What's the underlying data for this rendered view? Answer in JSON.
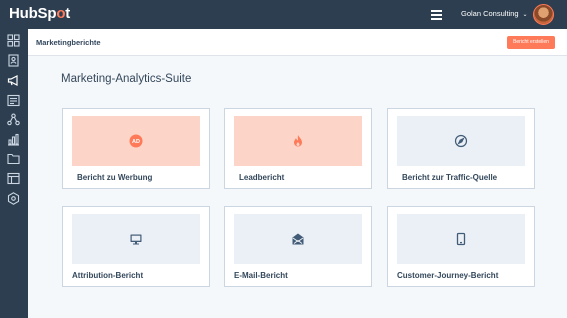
{
  "app": {
    "logo_pre": "HubSp",
    "logo_dot": "o",
    "logo_post": "t"
  },
  "topbar": {
    "account_name": "Golan Consulting"
  },
  "header": {
    "title": "Marketingberichte",
    "create_button": "Bericht erstellen"
  },
  "main": {
    "title": "Marketing-Analytics-Suite",
    "cards": [
      {
        "label": "Bericht zu Werbung",
        "icon": "ad-badge-icon",
        "ad_text": "AD",
        "tone": "orange"
      },
      {
        "label": "Leadbericht",
        "icon": "flame-icon",
        "tone": "orange"
      },
      {
        "label": "Bericht zur Traffic-Quelle",
        "icon": "compass-icon",
        "tone": "grey"
      },
      {
        "label": "Attribution-Bericht",
        "icon": "monitor-icon",
        "tone": "grey"
      },
      {
        "label": "E-Mail-Bericht",
        "icon": "open-envelope-icon",
        "tone": "grey"
      },
      {
        "label": "Customer-Journey-Bericht",
        "icon": "tablet-icon",
        "tone": "grey"
      }
    ]
  },
  "sidebar": {
    "items": [
      {
        "icon": "dashboard-grid-icon"
      },
      {
        "icon": "contacts-icon"
      },
      {
        "icon": "marketing-megaphone-icon"
      },
      {
        "icon": "content-icon"
      },
      {
        "icon": "automation-icon"
      },
      {
        "icon": "reports-bar-chart-icon"
      },
      {
        "icon": "folder-icon"
      },
      {
        "icon": "library-icon"
      },
      {
        "icon": "settings-hex-icon"
      }
    ]
  },
  "colors": {
    "nav": "#2d3e50",
    "accent": "#ff7a59",
    "card_orange": "#fdd5c8",
    "card_grey": "#eaf0f6",
    "icon_blue": "#425b76"
  }
}
